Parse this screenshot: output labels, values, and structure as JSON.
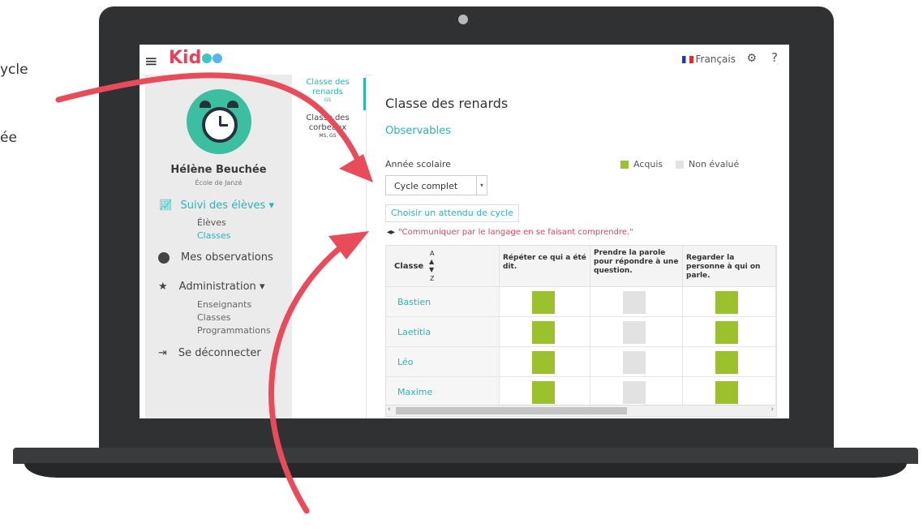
{
  "annotations": {
    "left_line1": "ycle",
    "left_line2": "ée"
  },
  "app": {
    "logo_text": "Kid",
    "lang": "Français",
    "help": "?"
  },
  "user": {
    "name": "Hélène Beuchée",
    "school": "École de Janzé"
  },
  "nav": {
    "suivi": "Suivi des élèves",
    "suivi_items": [
      "Élèves",
      "Classes"
    ],
    "observations": "Mes observations",
    "administration": "Administration",
    "admin_items": [
      "Enseignants",
      "Classes",
      "Programmations"
    ],
    "logout": "Se déconnecter"
  },
  "classes": [
    {
      "name": "Classe des renards",
      "level": "GS"
    },
    {
      "name": "Classe des corbeaux",
      "level": "MS, GS"
    }
  ],
  "main": {
    "title": "Classe des renards",
    "section": "Observables",
    "year_label": "Année scolaire",
    "year_value": "Cycle complet",
    "legend": {
      "acquired": "Acquis",
      "not_evaluated": "Non évalué"
    },
    "choose_button": "Choisir un attendu de cycle",
    "filter": "\"Communiquer par le langage en se faisant comprendre.\""
  },
  "table": {
    "col_class": "Classe",
    "sort_a": "A",
    "sort_z": "Z",
    "headers": [
      "Répéter ce qui a été dit.",
      "Prendre la parole pour répondre à une question.",
      "Regarder la personne à qui on parle."
    ],
    "rows": [
      {
        "name": "Bastien",
        "status": [
          "acquis",
          "non",
          "acquis"
        ]
      },
      {
        "name": "Laetitia",
        "status": [
          "acquis",
          "non",
          "acquis"
        ]
      },
      {
        "name": "Léo",
        "status": [
          "acquis",
          "non",
          "acquis"
        ]
      },
      {
        "name": "Maxime",
        "status": [
          "acquis",
          "non",
          "acquis"
        ]
      }
    ]
  },
  "colors": {
    "acquired": "#9bc22c",
    "not_evaluated": "#e2e2e2",
    "accent": "#2bb5b5",
    "brand": "#e8425a",
    "arrow": "#e84b5a"
  }
}
